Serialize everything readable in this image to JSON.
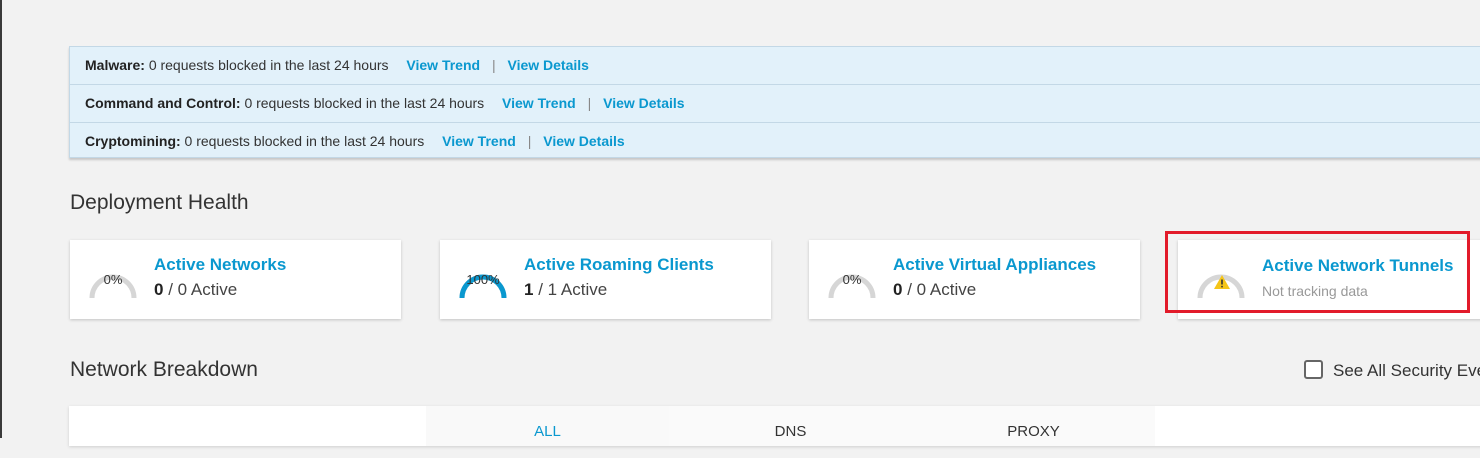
{
  "alerts": [
    {
      "label": "Malware:",
      "text": "0 requests blocked in the last 24 hours",
      "trend": "View Trend",
      "separator": "|",
      "details": "View Details"
    },
    {
      "label": "Command and Control:",
      "text": "0 requests blocked in the last 24 hours",
      "trend": "View Trend",
      "separator": "|",
      "details": "View Details"
    },
    {
      "label": "Cryptomining:",
      "text": "0 requests blocked in the last 24 hours",
      "trend": "View Trend",
      "separator": "|",
      "details": "View Details"
    }
  ],
  "deployment_health": {
    "heading": "Deployment Health",
    "cards": [
      {
        "title": "Active Networks",
        "percent": 0,
        "percent_label": "0%",
        "active": "0",
        "total_text": "/ 0 Active"
      },
      {
        "title": "Active Roaming Clients",
        "percent": 100,
        "percent_label": "100%",
        "active": "1",
        "total_text": "/ 1 Active"
      },
      {
        "title": "Active Virtual Appliances",
        "percent": 0,
        "percent_label": "0%",
        "active": "0",
        "total_text": "/ 0 Active"
      },
      {
        "title": "Active Network Tunnels",
        "status": "Not tracking data",
        "icon": "warning-icon"
      }
    ]
  },
  "network_breakdown": {
    "heading": "Network Breakdown",
    "see_all_label": "See All Security Eve",
    "see_all_checked": false,
    "tabs": [
      "ALL",
      "DNS",
      "PROXY"
    ],
    "active_tab": "ALL"
  },
  "colors": {
    "accent": "#0a98cf",
    "gauge_track": "#d6d6d6",
    "highlight": "#e21b2a",
    "warning": "#f5c518"
  }
}
